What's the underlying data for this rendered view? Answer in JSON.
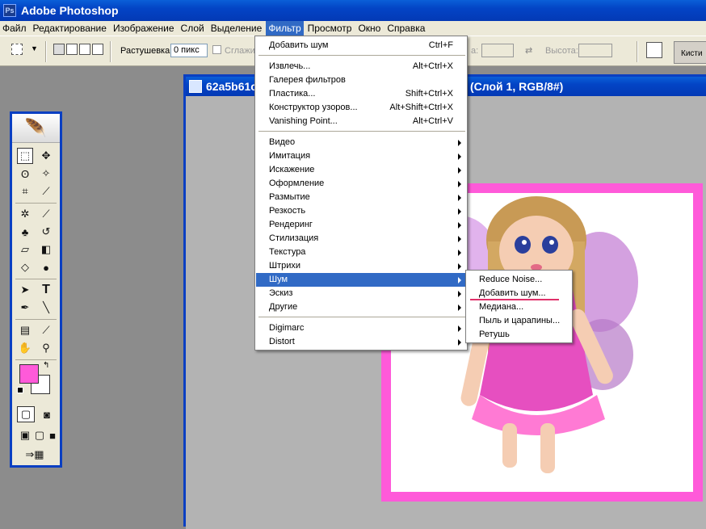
{
  "app": {
    "title": "Adobe Photoshop"
  },
  "menubar": [
    "Файл",
    "Редактирование",
    "Изображение",
    "Слой",
    "Выделение",
    "Фильтр",
    "Просмотр",
    "Окно",
    "Справка"
  ],
  "optionsbar": {
    "feather_label": "Растушевка:",
    "feather_value": "0 пикс",
    "antialias_label": "Сглажи",
    "width_label": "а:",
    "height_label": "Высота:",
    "brushes_tab": "Кисти"
  },
  "document": {
    "title_left": "62a5b61c",
    "title_right": "(Слой 1, RGB/8#)",
    "frame_color": "#ff5ad9"
  },
  "filter_menu": {
    "group1": [
      {
        "label": "Добавить шум",
        "shortcut": "Ctrl+F"
      }
    ],
    "group2": [
      {
        "label": "Извлечь...",
        "shortcut": "Alt+Ctrl+X"
      },
      {
        "label": "Галерея фильтров",
        "shortcut": ""
      },
      {
        "label": "Пластика...",
        "shortcut": "Shift+Ctrl+X"
      },
      {
        "label": "Конструктор узоров...",
        "shortcut": "Alt+Shift+Ctrl+X"
      },
      {
        "label": "Vanishing Point...",
        "shortcut": "Alt+Ctrl+V"
      }
    ],
    "group3": [
      "Видео",
      "Имитация",
      "Искажение",
      "Оформление",
      "Размытие",
      "Резкость",
      "Рендеринг",
      "Стилизация",
      "Текстура",
      "Штрихи",
      "Шум",
      "Эскиз",
      "Другие"
    ],
    "group4": [
      "Digimarc",
      "Distort"
    ],
    "highlighted": "Шум"
  },
  "noise_submenu": [
    "Reduce Noise...",
    "Добавить шум...",
    "Медиана...",
    "Пыль и царапины...",
    "Ретушь"
  ],
  "colors": {
    "accent": "#316ac5",
    "foreground": "#ff5ad9",
    "background": "#ffffff",
    "title_bar": "#0344c5"
  },
  "icons": [
    "feather-icon",
    "marquee-icon",
    "move-icon",
    "lasso-icon",
    "magic-wand-icon",
    "crop-icon",
    "slice-icon",
    "healing-icon",
    "brush-icon",
    "stamp-icon",
    "history-brush-icon",
    "eraser-icon",
    "gradient-icon",
    "blur-icon",
    "dodge-icon",
    "path-select-icon",
    "type-icon",
    "pen-icon",
    "line-icon",
    "notes-icon",
    "eyedropper-icon",
    "hand-icon",
    "zoom-icon"
  ]
}
